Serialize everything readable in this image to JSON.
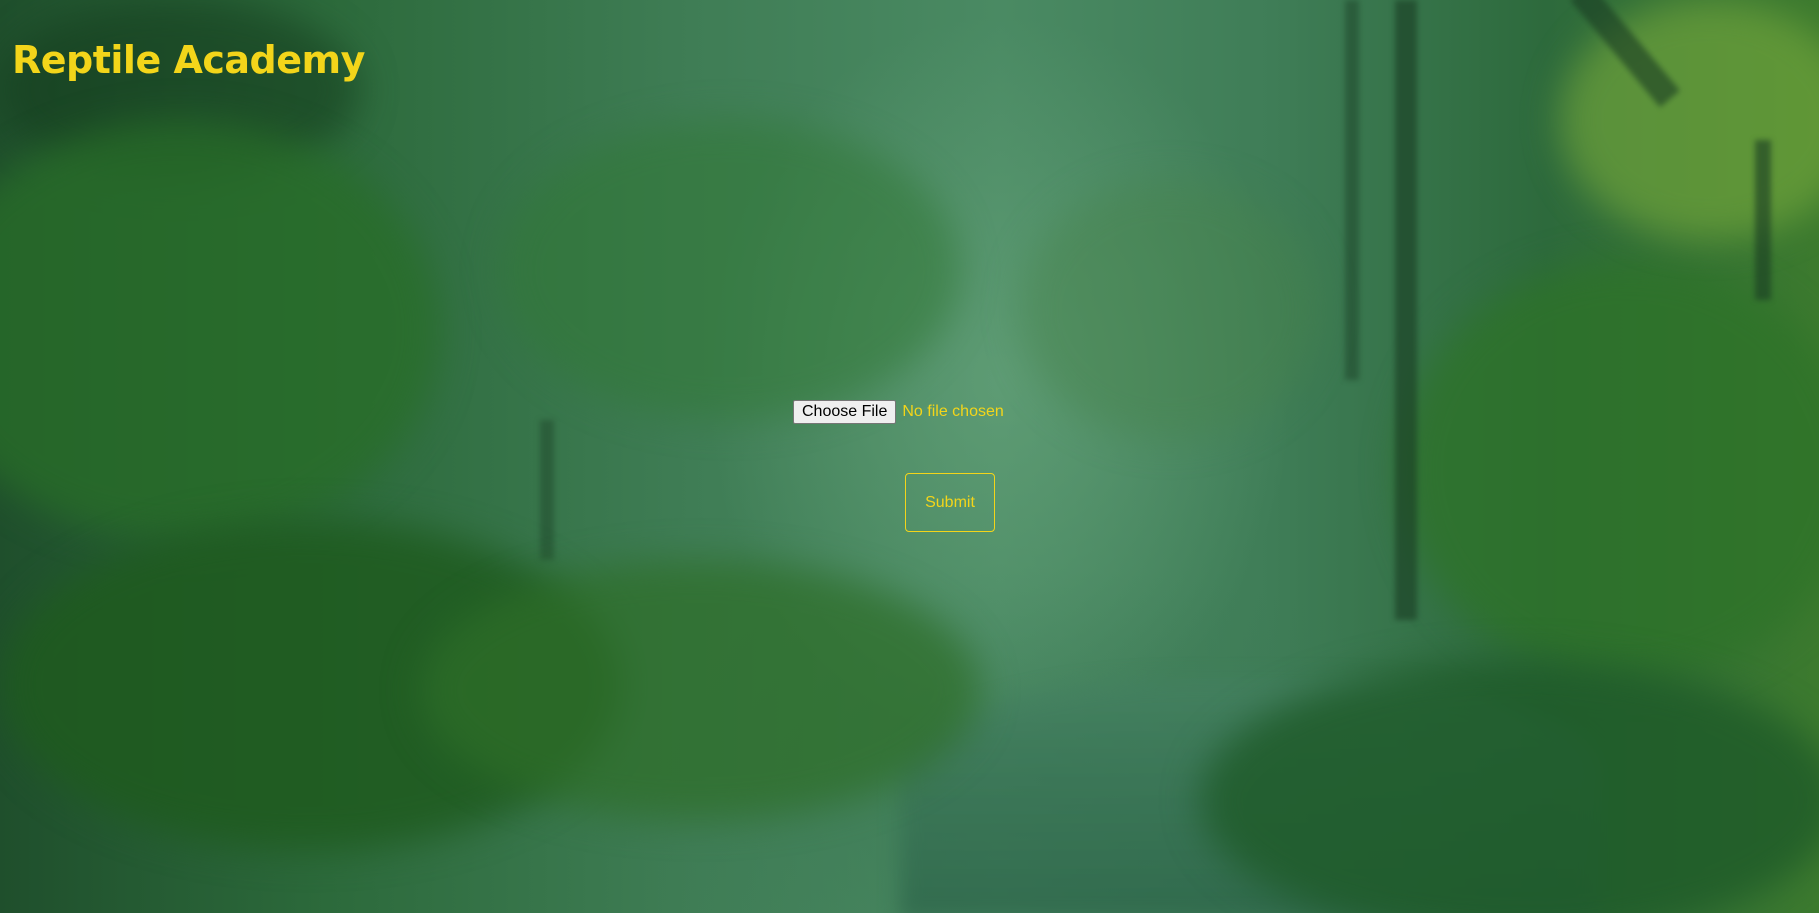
{
  "site": {
    "title": "Reptile Academy"
  },
  "upload": {
    "choose_file_label": "Choose File",
    "file_status": "No file chosen"
  },
  "form": {
    "submit_label": "Submit"
  },
  "colors": {
    "accent": "#f3d51a",
    "background": "#2f6a45"
  }
}
